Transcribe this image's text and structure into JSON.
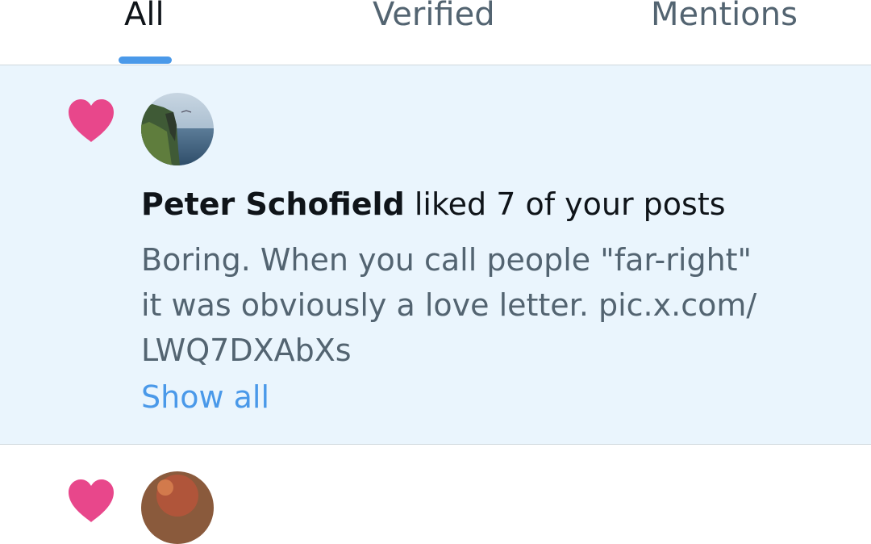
{
  "tabs": [
    {
      "label": "All",
      "active": true
    },
    {
      "label": "Verified",
      "active": false
    },
    {
      "label": "Mentions",
      "active": false
    }
  ],
  "colors": {
    "accent": "#4a99e9",
    "like": "#e8478b",
    "highlight_bg": "#eaf5fd",
    "text_primary": "#0f1419",
    "text_secondary": "#536471"
  },
  "notifications": [
    {
      "icon": "heart-icon",
      "avatar": "avatar-cliff-landscape",
      "user_name": "Peter Schofield",
      "action_text": "liked 7 of your posts",
      "post_lines": [
        "Boring. When you call people \"far-right\"",
        "it was obviously a love letter. pic.x.com/",
        "LWQ7DXAbXs"
      ],
      "show_all_label": "Show all"
    },
    {
      "icon": "heart-icon",
      "avatar": "avatar-brown"
    }
  ]
}
